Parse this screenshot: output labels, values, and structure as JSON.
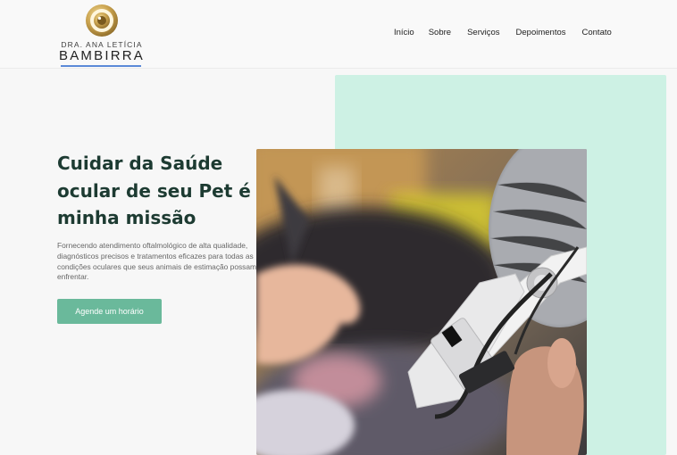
{
  "brand": {
    "line1": "DRA. ANA LETÍCIA",
    "line2": "BAMBIRRA"
  },
  "nav": {
    "items": [
      "Início",
      "Sobre",
      "Serviços",
      "Depoimentos",
      "Contato"
    ]
  },
  "hero": {
    "title": "Cuidar da Saúde ocular de seu Pet é minha missão",
    "description": "Fornecendo atendimento oftalmológico de alta qualidade, diagnósticos precisos e tratamentos eficazes para todas as condições oculares que seus animais de estimação possam enfrentar.",
    "cta_label": "Agende um horário"
  },
  "colors": {
    "accent": "#6ab99b",
    "mint_panel": "#cdf1e4",
    "title": "#1d3b32",
    "logo_gold": "#c9a24e",
    "logo_underline": "#5c8ad8"
  },
  "icons": {
    "logo": "eye-icon"
  }
}
